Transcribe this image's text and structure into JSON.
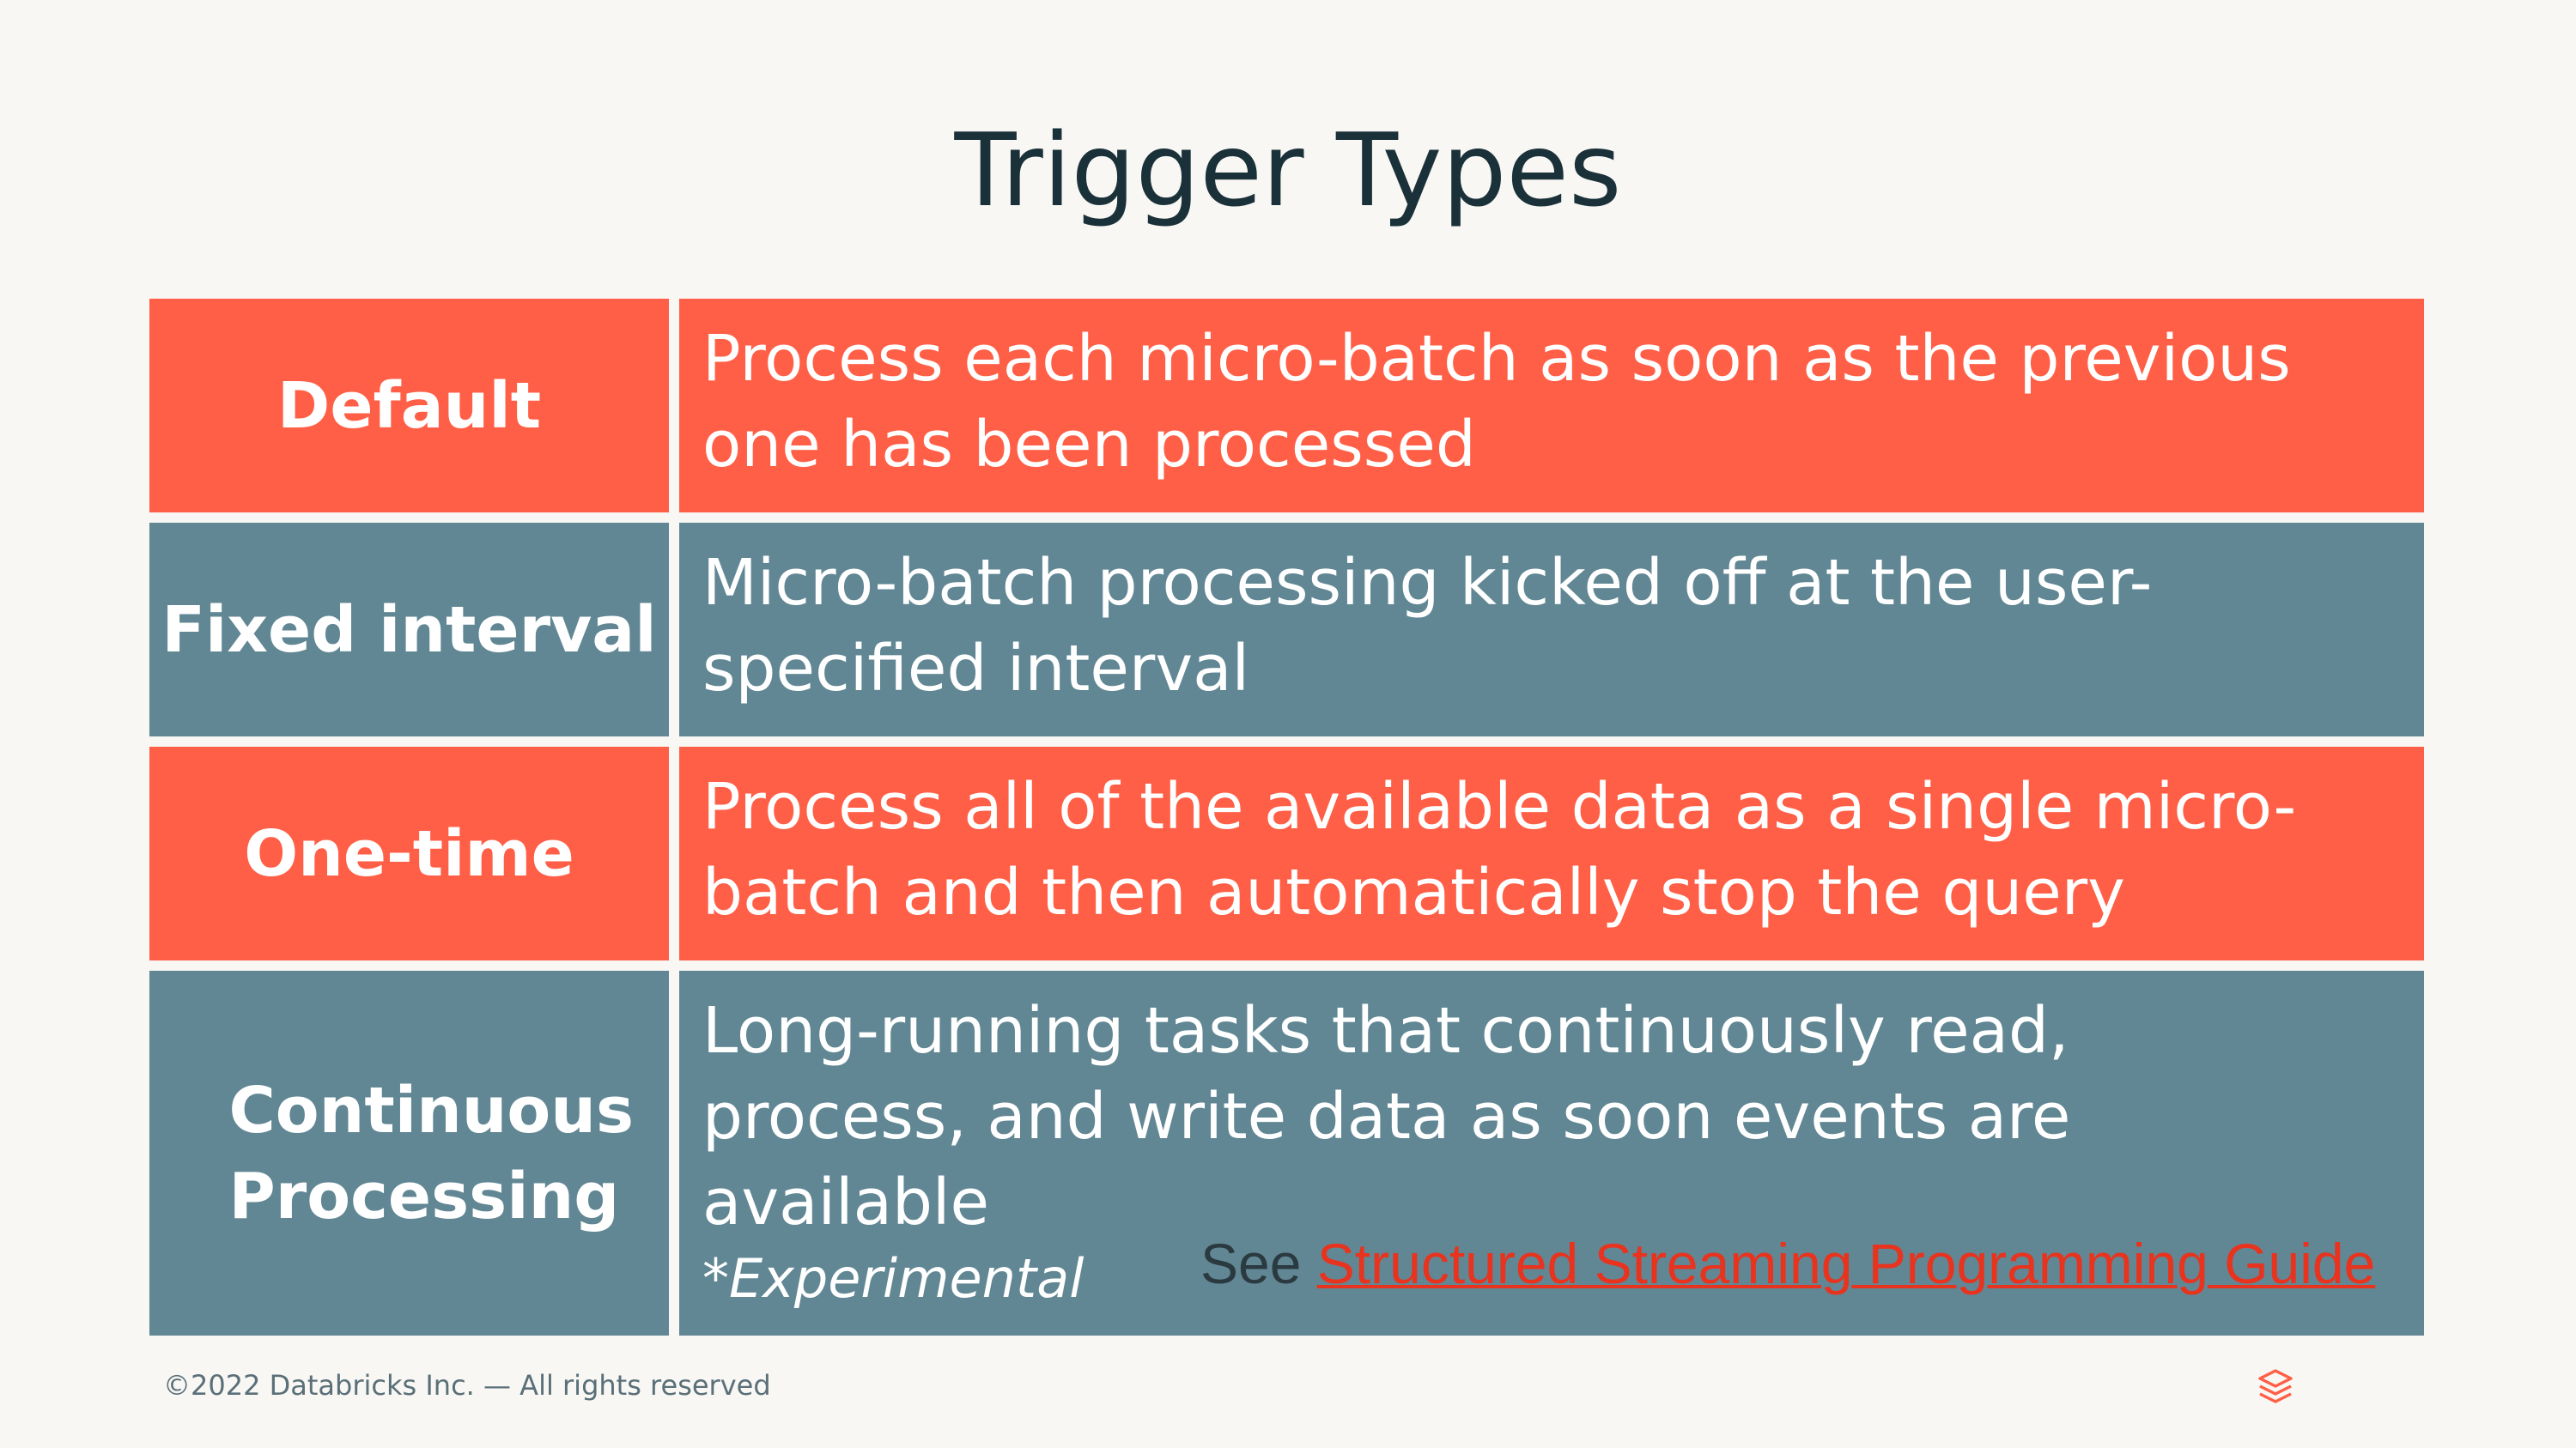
{
  "slide": {
    "title": "Trigger Types"
  },
  "rows": [
    {
      "label": "Default",
      "description": "Process each micro-batch as soon as the previous one has been processed"
    },
    {
      "label": "Fixed interval",
      "description": "Micro-batch processing kicked off at the user-specified interval"
    },
    {
      "label": "One-time",
      "description": "Process all of the available data as a single micro-batch and then automatically stop the query"
    },
    {
      "label": "Continuous Processing",
      "description": "Long-running tasks that continuously read, process, and write data as soon events are available",
      "note": "*Experimental"
    }
  ],
  "reference": {
    "prefix": "See",
    "link_text": "Structured Streaming Programming Guide"
  },
  "footer": {
    "copyright": "©2022 Databricks Inc. — All rights reserved"
  },
  "icons": {
    "logo": "databricks-logo-icon"
  },
  "colors": {
    "background": "#F8F7F4",
    "title": "#1B3139",
    "orange_row": "#FF5F46",
    "slate_row": "#618794",
    "link": "#E8331E"
  }
}
